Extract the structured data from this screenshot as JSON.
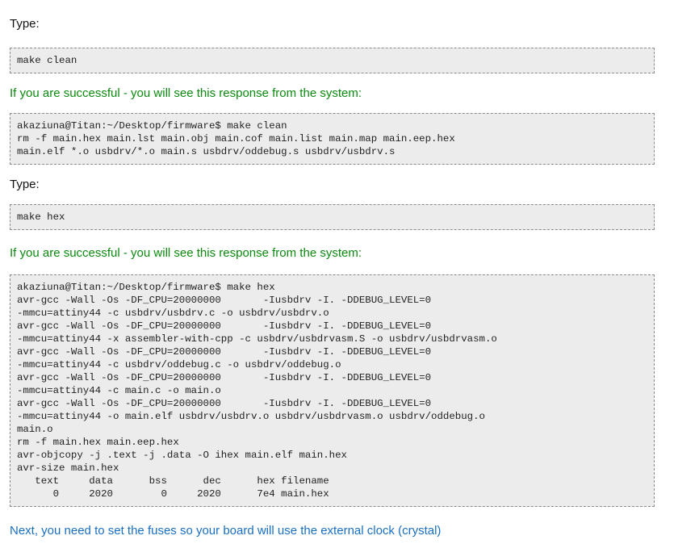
{
  "steps": [
    {
      "type_label": "Type:",
      "command": "make clean"
    },
    {
      "success_text": "If you are successful - you will see this response from the system:",
      "output_lines": [
        "akaziuna@Titan:~/Desktop/firmware$ make clean",
        "rm -f main.hex main.lst main.obj main.cof main.list main.map main.eep.hex",
        "main.elf *.o usbdrv/*.o main.s usbdrv/oddebug.s usbdrv/usbdrv.s"
      ]
    },
    {
      "type_label": "Type:",
      "command": "make hex"
    },
    {
      "success_text": "If you are successful - you will see this response from the system:",
      "output_lines": [
        "akaziuna@Titan:~/Desktop/firmware$ make hex",
        "avr-gcc -Wall -Os -DF_CPU=20000000       -Iusbdrv -I. -DDEBUG_LEVEL=0",
        "-mmcu=attiny44 -c usbdrv/usbdrv.c -o usbdrv/usbdrv.o",
        "avr-gcc -Wall -Os -DF_CPU=20000000       -Iusbdrv -I. -DDEBUG_LEVEL=0",
        "-mmcu=attiny44 -x assembler-with-cpp -c usbdrv/usbdrvasm.S -o usbdrv/usbdrvasm.o",
        "avr-gcc -Wall -Os -DF_CPU=20000000       -Iusbdrv -I. -DDEBUG_LEVEL=0",
        "-mmcu=attiny44 -c usbdrv/oddebug.c -o usbdrv/oddebug.o",
        "avr-gcc -Wall -Os -DF_CPU=20000000       -Iusbdrv -I. -DDEBUG_LEVEL=0",
        "-mmcu=attiny44 -c main.c -o main.o",
        "avr-gcc -Wall -Os -DF_CPU=20000000       -Iusbdrv -I. -DDEBUG_LEVEL=0",
        "-mmcu=attiny44 -o main.elf usbdrv/usbdrv.o usbdrv/usbdrvasm.o usbdrv/oddebug.o",
        "main.o",
        "rm -f main.hex main.eep.hex",
        "avr-objcopy -j .text -j .data -O ihex main.elf main.hex",
        "avr-size main.hex",
        "   text\t   data\t    bss\t    dec\t    hex filename",
        "      0\t   2020\t      0\t   2020\t    7e4 main.hex"
      ]
    }
  ],
  "next_text": "Next, you need to set the fuses so your board will use the external clock (crystal)",
  "colors": {
    "success_green": "#0c8a10",
    "next_blue": "#1a6fc0",
    "code_background": "#ececec",
    "code_border": "#8c8c8c"
  }
}
